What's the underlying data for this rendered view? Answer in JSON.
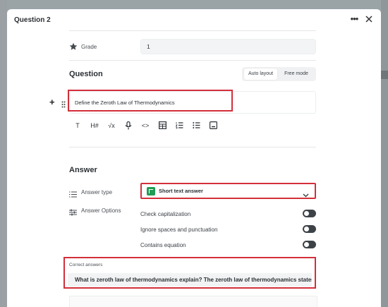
{
  "modal": {
    "title": "Question 2",
    "more_icon": "more-horizontal-icon",
    "close_icon": "close-icon"
  },
  "grade": {
    "label": "Grade",
    "value": "1",
    "icon": "star-icon"
  },
  "question": {
    "heading": "Question",
    "layout_options": [
      "Auto layout",
      "Free mode"
    ],
    "selected_layout": "Auto layout",
    "text": "Define the Zeroth Law of Thermodynamics",
    "toolbar": [
      {
        "icon": "text-format-icon",
        "glyph": "T"
      },
      {
        "icon": "heading-icon",
        "glyph": "H#"
      },
      {
        "icon": "math-formula-icon",
        "glyph": "√x"
      },
      {
        "icon": "microphone-icon",
        "glyph": ""
      },
      {
        "icon": "code-icon",
        "glyph": "<>"
      },
      {
        "icon": "table-icon",
        "glyph": ""
      },
      {
        "icon": "numbered-list-icon",
        "glyph": ""
      },
      {
        "icon": "bullet-list-icon",
        "glyph": ""
      },
      {
        "icon": "image-icon",
        "glyph": ""
      }
    ]
  },
  "answer": {
    "heading": "Answer",
    "type_label": "Answer type",
    "type_value": "Short text answer",
    "options_label": "Answer Options",
    "options": [
      {
        "label": "Check capitalization",
        "enabled": false
      },
      {
        "label": "Ignore spaces and punctuation",
        "enabled": false
      },
      {
        "label": "Contains equation",
        "enabled": false
      }
    ],
    "correct_label": "Correct answers",
    "correct_value": "What is zeroth law of thermodynamics explain? The zeroth law of thermodynamics states that"
  },
  "colors": {
    "highlight": "#d32f3a",
    "short_text_icon": "#1f9d55"
  }
}
